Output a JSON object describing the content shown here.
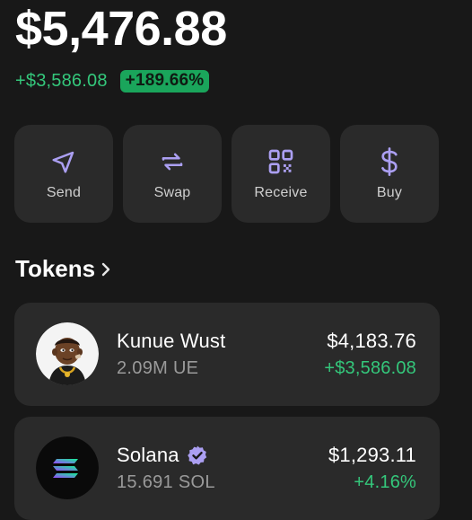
{
  "portfolio": {
    "balance": "$5,476.88",
    "change_amount": "+$3,586.08",
    "change_percent": "+189.66%"
  },
  "actions": [
    {
      "label": "Send",
      "icon": "send-icon"
    },
    {
      "label": "Swap",
      "icon": "swap-icon"
    },
    {
      "label": "Receive",
      "icon": "qr-code-icon"
    },
    {
      "label": "Buy",
      "icon": "dollar-icon"
    }
  ],
  "tokens": {
    "title": "Tokens",
    "items": [
      {
        "name": "Kunue Wust",
        "amount": "2.09M UE",
        "value": "$4,183.76",
        "change": "+$3,586.08",
        "icon": "kunue-wust-avatar",
        "verified": false
      },
      {
        "name": "Solana",
        "amount": "15.691 SOL",
        "value": "$1,293.11",
        "change": "+4.16%",
        "icon": "solana-logo-icon",
        "verified": true
      }
    ]
  },
  "colors": {
    "background": "#181818",
    "card": "#2a2a2a",
    "positive": "#34c77b",
    "accent_purple": "#ab9ff2",
    "muted_text": "#9a9a9a"
  }
}
